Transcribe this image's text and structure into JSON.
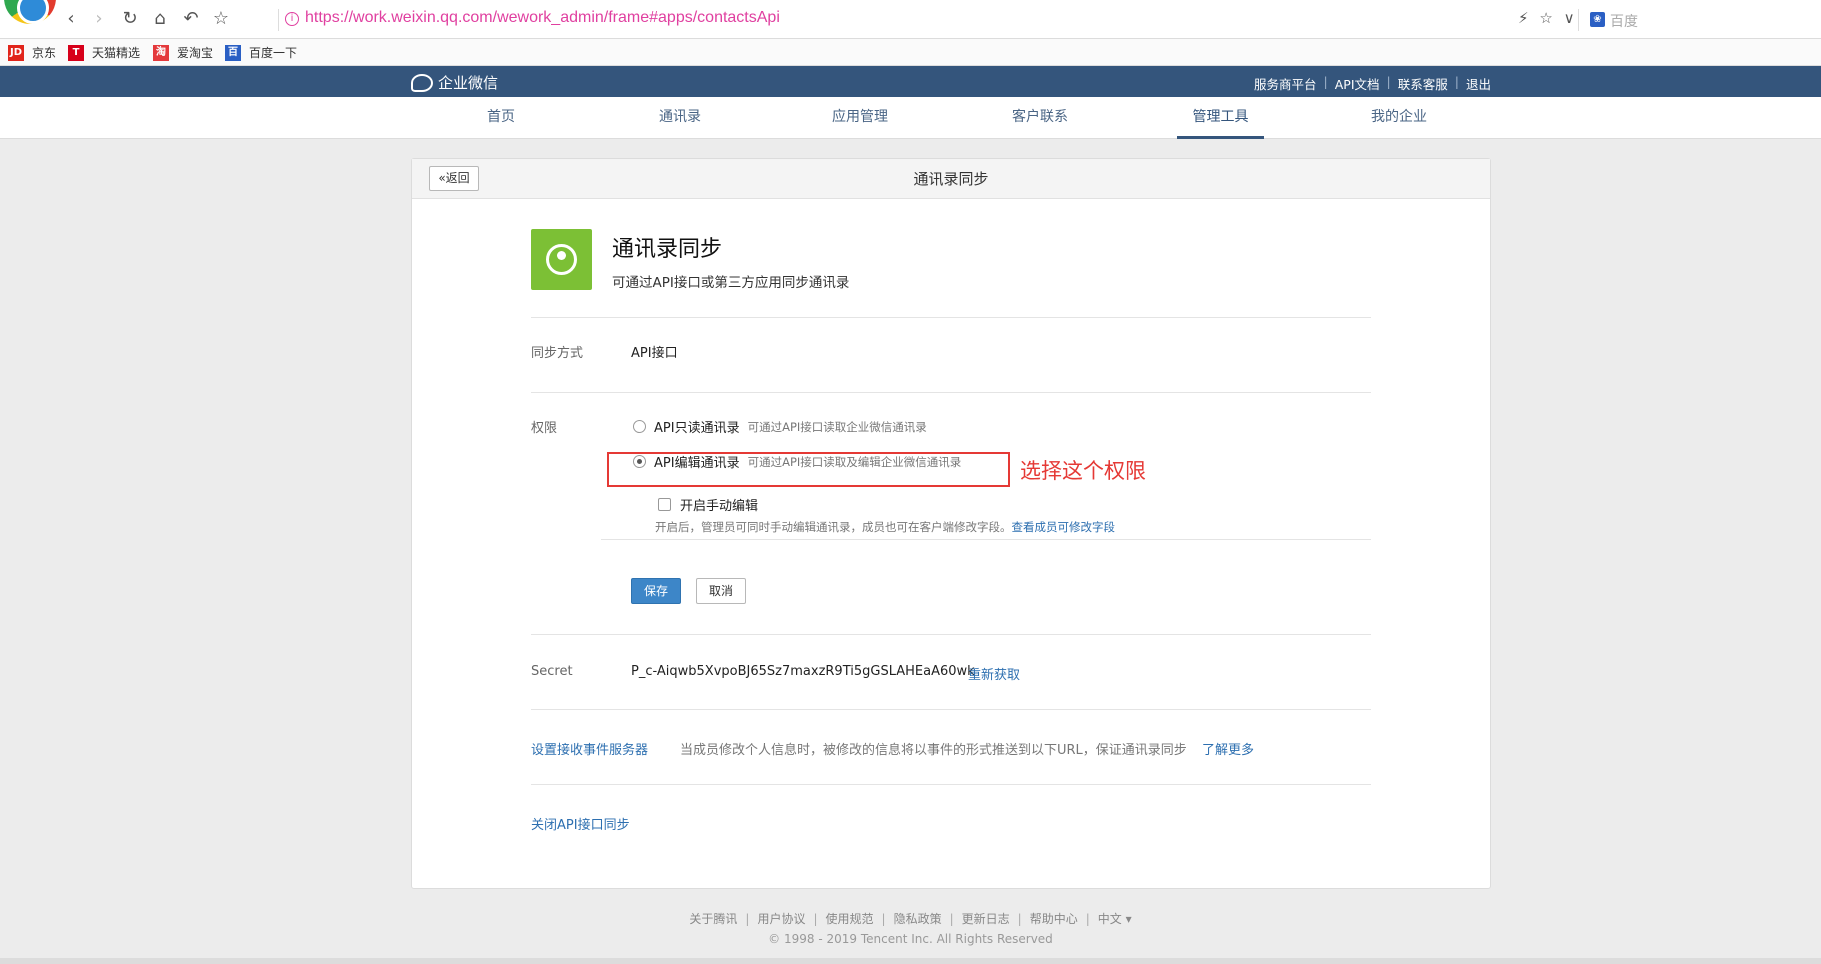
{
  "browser": {
    "url": "https://work.weixin.qq.com/wework_admin/frame#apps/contactsApi",
    "search_placeholder": "百度",
    "bookmarks": [
      {
        "label": "京东",
        "icon": "JD",
        "color": "#e1251b"
      },
      {
        "label": "天猫精选",
        "icon": "T",
        "color": "#d7001a"
      },
      {
        "label": "爱淘宝",
        "icon": "淘",
        "color": "#e4393c"
      },
      {
        "label": "百度一下",
        "icon": "百",
        "color": "#2a5fc4"
      }
    ]
  },
  "header": {
    "brand": "企业微信",
    "links": [
      "服务商平台",
      "API文档",
      "联系客服",
      "退出"
    ]
  },
  "nav": {
    "items": [
      "首页",
      "通讯录",
      "应用管理",
      "客户联系",
      "管理工具",
      "我的企业"
    ],
    "active_index": 4
  },
  "card": {
    "back_label": "返回",
    "title": "通讯录同步",
    "app_name": "通讯录同步",
    "app_desc": "可通过API接口或第三方应用同步通讯录",
    "sync_method_label": "同步方式",
    "sync_method_value": "API接口",
    "permission_label": "权限",
    "permission_options": [
      {
        "title": "API只读通讯录",
        "desc": "可通过API接口读取企业微信通讯录",
        "checked": false
      },
      {
        "title": "API编辑通讯录",
        "desc": "可通过API接口读取及编辑企业微信通讯录",
        "checked": true
      }
    ],
    "annotation": "选择这个权限",
    "manual_edit_label": "开启手动编辑",
    "manual_edit_hint": "开启后，管理员可同时手动编辑通讯录，成员也可在客户端修改字段。",
    "manual_edit_hint_link": "查看成员可修改字段",
    "save_label": "保存",
    "cancel_label": "取消",
    "secret_label": "Secret",
    "secret_value": "P_c-Aiqwb5XvpoBJ65Sz7maxzR9Ti5gGSLAHEaA60wk",
    "secret_refresh": "重新获取",
    "event_server_link": "设置接收事件服务器",
    "event_server_desc": "当成员修改个人信息时，被修改的信息将以事件的形式推送到以下URL，保证通讯录同步",
    "event_server_more": "了解更多",
    "close_api": "关闭API接口同步"
  },
  "footer": {
    "links": [
      "关于腾讯",
      "用户协议",
      "使用规范",
      "隐私政策",
      "更新日志",
      "帮助中心",
      "中文 ▾"
    ],
    "copyright": "© 1998 - 2019 Tencent Inc. All Rights Reserved"
  },
  "colors": {
    "header_bg": "#34557c",
    "link": "#2d6fb0",
    "primary_button": "#3d86c8",
    "annotation": "#e53935",
    "app_icon": "#7cc035"
  }
}
